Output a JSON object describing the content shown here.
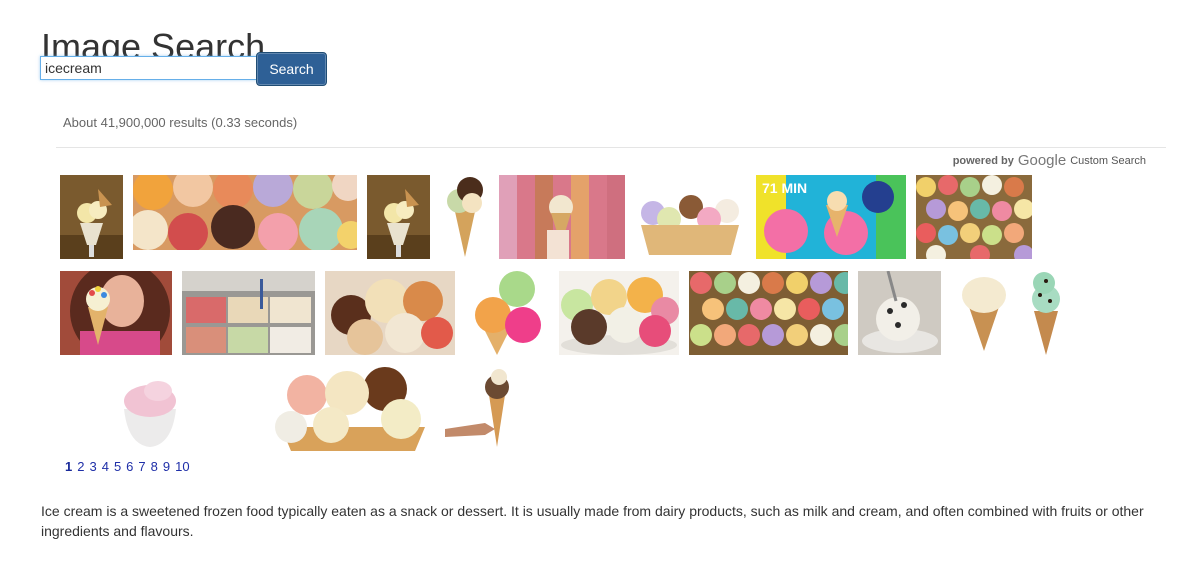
{
  "header": {
    "title": "Image Search"
  },
  "search": {
    "value": "icecream",
    "button_label": "Search"
  },
  "results": {
    "stats": "About 41,900,000 results (0.33 seconds)",
    "branding": {
      "powered_by": "powered by",
      "google": "Google",
      "custom_search": "Custom Search"
    }
  },
  "thumbnails": [
    {
      "name": "cone-dessert-glass"
    },
    {
      "name": "scoops-assortment"
    },
    {
      "name": "cone-dessert-glass-2"
    },
    {
      "name": "double-scoop-cone"
    },
    {
      "name": "sprinkles-cone"
    },
    {
      "name": "scoop-cups-row"
    },
    {
      "name": "video-thumbnail-cones"
    },
    {
      "name": "cupcake-grid"
    },
    {
      "name": "woman-tall-cone"
    },
    {
      "name": "gelato-display"
    },
    {
      "name": "scoops-bowl"
    },
    {
      "name": "three-scoop-cone"
    },
    {
      "name": "scoops-plate"
    },
    {
      "name": "cupcake-grid-2"
    },
    {
      "name": "cookie-scoop-dish"
    },
    {
      "name": "vanilla-cone"
    },
    {
      "name": "mint-chip-cone"
    },
    {
      "name": "pink-scoop-bowl"
    },
    {
      "name": "cones-group"
    },
    {
      "name": "hand-holding-cone"
    }
  ],
  "pagination": {
    "pages": [
      "1",
      "2",
      "3",
      "4",
      "5",
      "6",
      "7",
      "8",
      "9",
      "10"
    ],
    "current": "1"
  },
  "description": "Ice cream is a sweetened frozen food typically eaten as a snack or dessert. It is usually made from dairy products, such as milk and cream, and often combined with fruits or other ingredients and flavours."
}
